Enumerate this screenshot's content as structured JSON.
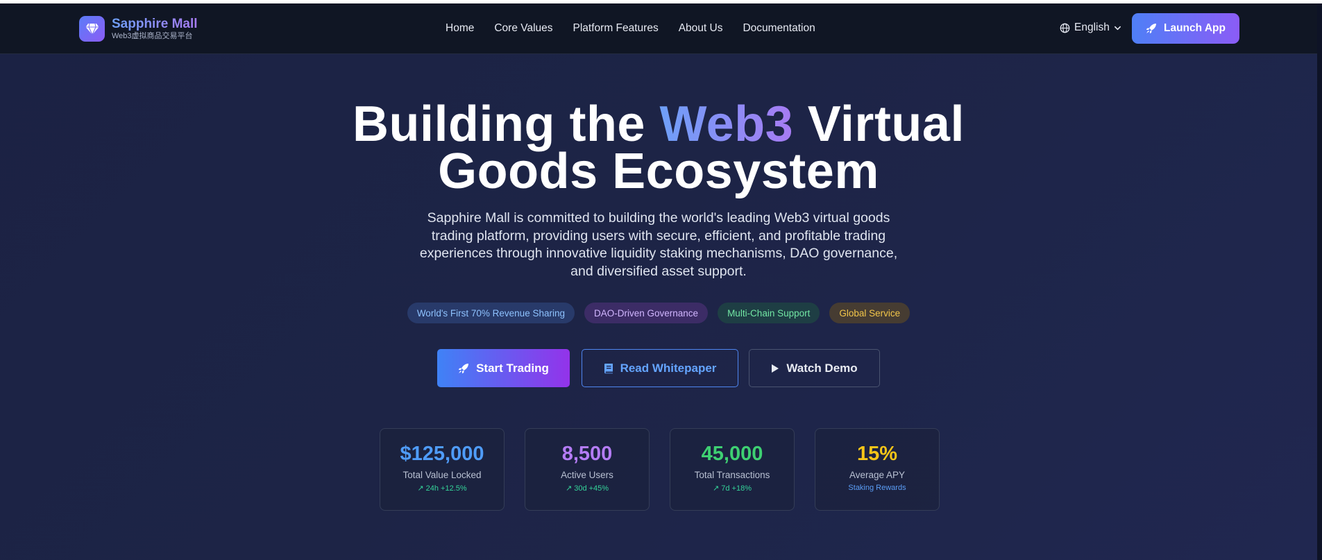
{
  "navbar": {
    "brand_name": "Sapphire Mall",
    "brand_subtitle": "Web3虚拟商品交易平台",
    "links": [
      "Home",
      "Core Values",
      "Platform Features",
      "About Us",
      "Documentation"
    ],
    "language": "English",
    "launch_label": "Launch App"
  },
  "hero": {
    "title_part1": "Building the ",
    "title_highlight": "Web3",
    "title_part2": " Virtual",
    "title_line2": "Goods Ecosystem",
    "description": "Sapphire Mall is committed to building the world's leading Web3 virtual goods trading platform, providing users with secure, efficient, and profitable trading experiences through innovative liquidity staking mechanisms, DAO governance, and diversified asset support."
  },
  "tags": [
    {
      "label": "World's First 70% Revenue Sharing",
      "color": "blue"
    },
    {
      "label": "DAO-Driven Governance",
      "color": "purple"
    },
    {
      "label": "Multi-Chain Support",
      "color": "green"
    },
    {
      "label": "Global Service",
      "color": "yellow"
    }
  ],
  "actions": {
    "start_trading": "Start Trading",
    "read_whitepaper": "Read Whitepaper",
    "watch_demo": "Watch Demo"
  },
  "stats": [
    {
      "value": "$125,000",
      "label": "Total Value Locked",
      "sub": "↗ 24h +12.5%",
      "value_color": "#4f9cf9",
      "sub_color": "#34d399"
    },
    {
      "value": "8,500",
      "label": "Active Users",
      "sub": "↗ 30d +45%",
      "value_color": "#b47cf5",
      "sub_color": "#34d399"
    },
    {
      "value": "45,000",
      "label": "Total Transactions",
      "sub": "↗ 7d +18%",
      "value_color": "#3ed072",
      "sub_color": "#34d399"
    },
    {
      "value": "15%",
      "label": "Average APY",
      "sub": "Staking Rewards",
      "value_color": "#f5c518",
      "sub_color": "#5b9df6"
    }
  ],
  "icons": {
    "brand": "gem-icon",
    "language": "globe-icon",
    "dropdown": "chevron-down-icon",
    "launch": "rocket-icon",
    "whitepaper": "book-icon",
    "demo": "play-icon"
  }
}
